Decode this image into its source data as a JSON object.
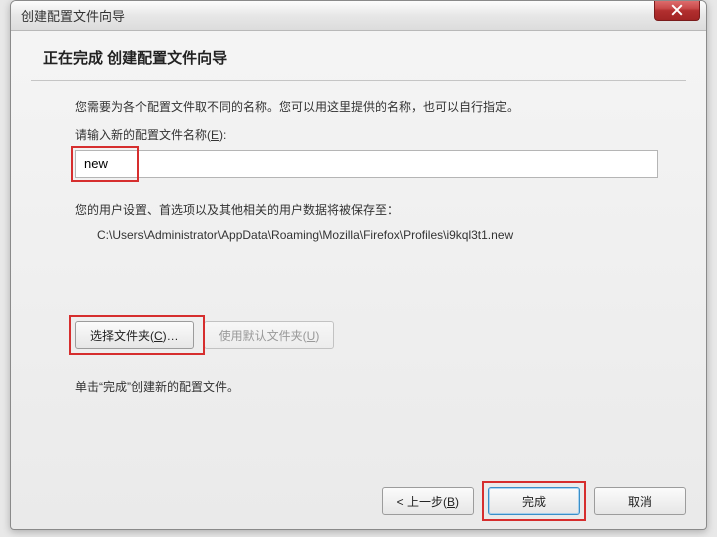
{
  "window": {
    "title": "创建配置文件向导"
  },
  "wizard": {
    "heading": "正在完成 创建配置文件向导",
    "intro": "您需要为各个配置文件取不同的名称。您可以用这里提供的名称，也可以自行指定。",
    "input_label_prefix": "请输入新的配置文件名称(",
    "input_label_accel": "E",
    "input_label_suffix": "):",
    "input_value": "new",
    "save_note": "您的用户设置、首选项以及其他相关的用户数据将被保存至：",
    "save_path": "C:\\Users\\Administrator\\AppData\\Roaming\\Mozilla\\Firefox\\Profiles\\i9kql3t1.new",
    "choose_folder_prefix": "选择文件夹(",
    "choose_folder_accel": "C",
    "choose_folder_suffix": ")…",
    "use_default_prefix": "使用默认文件夹(",
    "use_default_accel": "U",
    "use_default_suffix": ")",
    "hint": "单击“完成”创建新的配置文件。"
  },
  "footer": {
    "back_prefix": "< 上一步(",
    "back_accel": "B",
    "back_suffix": ")",
    "finish": "完成",
    "cancel": "取消"
  }
}
